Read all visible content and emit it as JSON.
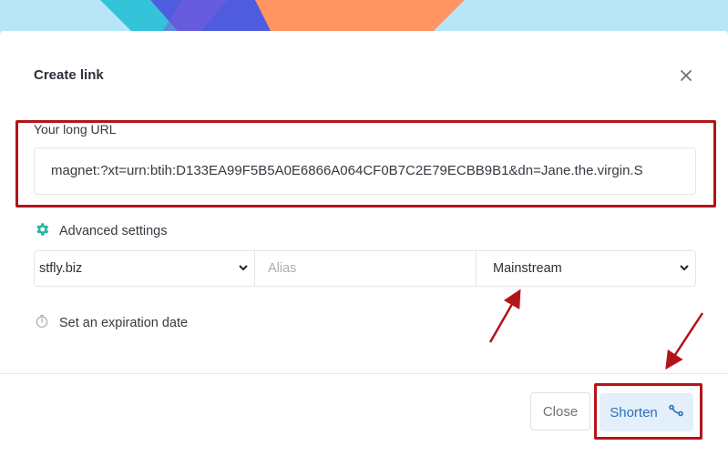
{
  "modal": {
    "title": "Create link",
    "close_icon": "close-icon"
  },
  "url_field": {
    "label": "Your long URL",
    "value": "magnet:?xt=urn:btih:D133EA99F5B5A0E6866A064CF0B7C2E79ECBB9B1&dn=Jane.the.virgin.S"
  },
  "advanced": {
    "icon": "gear-icon",
    "label": "Advanced settings",
    "domain": "stfly.biz",
    "alias_placeholder": "Alias",
    "link_type": "Mainstream"
  },
  "expiration": {
    "icon": "stopwatch-icon",
    "label": "Set an expiration date"
  },
  "footer": {
    "close_label": "Close",
    "shorten_label": "Shorten",
    "shorten_icon": "link-icon"
  },
  "colors": {
    "accent_green": "#29b6a0",
    "shorten_bg": "#e3effb",
    "shorten_text": "#2f6fb5",
    "annotation_red": "#b3141a"
  }
}
